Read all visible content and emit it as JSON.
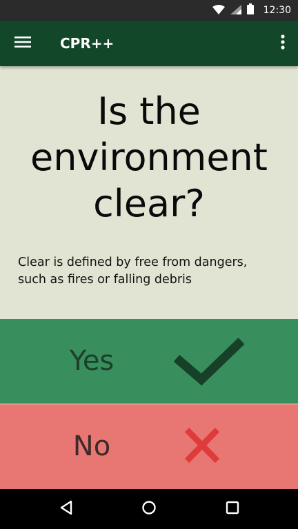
{
  "status_bar": {
    "time": "12:30",
    "icons": [
      "wifi-icon",
      "signal-icon",
      "battery-icon"
    ]
  },
  "app_bar": {
    "title": "CPR++",
    "menu_icon": "menu-icon",
    "overflow_icon": "more-vert-icon",
    "color": "#13472a"
  },
  "question": {
    "lines": [
      "Is the",
      "environment",
      "clear?"
    ]
  },
  "description": {
    "lines": [
      "Clear is defined by free from dangers,",
      "such as fires or falling debris"
    ]
  },
  "answers": {
    "yes": {
      "label": "Yes",
      "icon": "checkmark-icon",
      "color": "#388e5c"
    },
    "no": {
      "label": "No",
      "icon": "cross-icon",
      "color": "#e87773"
    }
  },
  "nav_bar": {
    "icons": [
      "back-icon",
      "home-icon",
      "recents-icon"
    ]
  }
}
